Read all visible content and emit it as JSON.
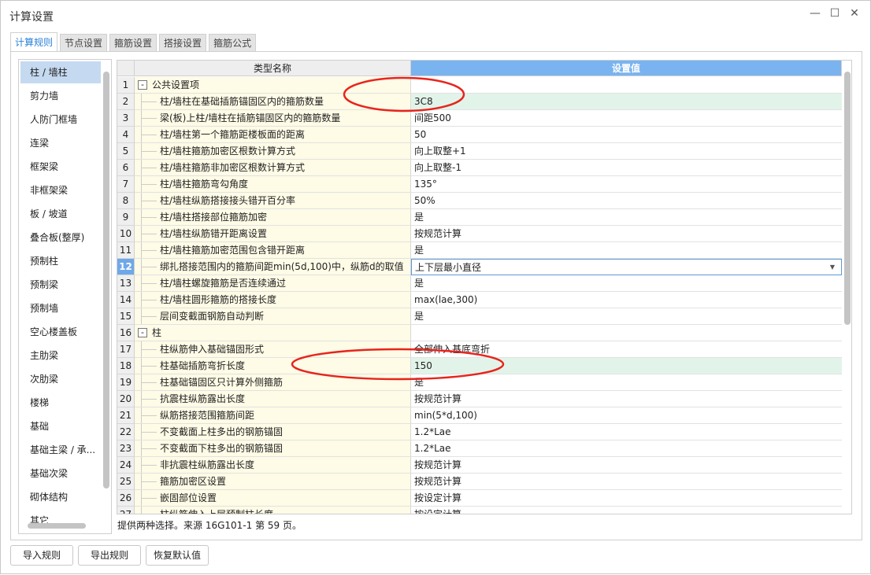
{
  "window": {
    "title": "计算设置",
    "controls": [
      "—",
      "☐",
      "✕"
    ]
  },
  "tabs": [
    "计算规则",
    "节点设置",
    "箍筋设置",
    "搭接设置",
    "箍筋公式"
  ],
  "left_list": [
    "柱 / 墙柱",
    "剪力墙",
    "人防门框墙",
    "连梁",
    "框架梁",
    "非框架梁",
    "板 / 坡道",
    "叠合板(整厚)",
    "预制柱",
    "预制梁",
    "预制墙",
    "空心楼盖板",
    "主肋梁",
    "次肋梁",
    "楼梯",
    "基础",
    "基础主梁 / 承...",
    "基础次梁",
    "砌体结构",
    "其它"
  ],
  "grid": {
    "headers": {
      "name": "类型名称",
      "value": "设置值"
    },
    "current_row": 12,
    "rows": [
      {
        "n": "1",
        "group": true,
        "name": "公共设置项",
        "value": ""
      },
      {
        "n": "2",
        "name": "柱/墙柱在基础插筋锚固区内的箍筋数量",
        "value": "3C8",
        "highlight": true
      },
      {
        "n": "3",
        "name": "梁(板)上柱/墙柱在插筋锚固区内的箍筋数量",
        "value": "间距500"
      },
      {
        "n": "4",
        "name": "柱/墙柱第一个箍筋距楼板面的距离",
        "value": "50"
      },
      {
        "n": "5",
        "name": "柱/墙柱箍筋加密区根数计算方式",
        "value": "向上取整+1"
      },
      {
        "n": "6",
        "name": "柱/墙柱箍筋非加密区根数计算方式",
        "value": "向上取整-1"
      },
      {
        "n": "7",
        "name": "柱/墙柱箍筋弯勾角度",
        "value": "135°"
      },
      {
        "n": "8",
        "name": "柱/墙柱纵筋搭接接头错开百分率",
        "value": "50%"
      },
      {
        "n": "9",
        "name": "柱/墙柱搭接部位箍筋加密",
        "value": "是"
      },
      {
        "n": "10",
        "name": "柱/墙柱纵筋错开距离设置",
        "value": "按规范计算"
      },
      {
        "n": "11",
        "name": "柱/墙柱箍筋加密范围包含错开距离",
        "value": "是"
      },
      {
        "n": "12",
        "name": "绑扎搭接范围内的箍筋间距min(5d,100)中，纵筋d的取值",
        "value": "上下层最小直径",
        "editing": true
      },
      {
        "n": "13",
        "name": "柱/墙柱螺旋箍筋是否连续通过",
        "value": "是"
      },
      {
        "n": "14",
        "name": "柱/墙柱圆形箍筋的搭接长度",
        "value": "max(lae,300)"
      },
      {
        "n": "15",
        "name": "层间变截面钢筋自动判断",
        "value": "是"
      },
      {
        "n": "16",
        "group": true,
        "name": "柱",
        "value": ""
      },
      {
        "n": "17",
        "name": "柱纵筋伸入基础锚固形式",
        "value": "全部伸入基底弯折"
      },
      {
        "n": "18",
        "name": "柱基础插筋弯折长度",
        "value": "150",
        "highlight": true
      },
      {
        "n": "19",
        "name": "柱基础锚固区只计算外侧箍筋",
        "value": "是"
      },
      {
        "n": "20",
        "name": "抗震柱纵筋露出长度",
        "value": "按规范计算"
      },
      {
        "n": "21",
        "name": "纵筋搭接范围箍筋间距",
        "value": "min(5*d,100)"
      },
      {
        "n": "22",
        "name": "不变截面上柱多出的钢筋锚固",
        "value": "1.2*Lae"
      },
      {
        "n": "23",
        "name": "不变截面下柱多出的钢筋锚固",
        "value": "1.2*Lae"
      },
      {
        "n": "24",
        "name": "非抗震柱纵筋露出长度",
        "value": "按规范计算"
      },
      {
        "n": "25",
        "name": "箍筋加密区设置",
        "value": "按规范计算"
      },
      {
        "n": "26",
        "name": "嵌固部位设置",
        "value": "按设定计算"
      },
      {
        "n": "27",
        "name": "柱纵筋伸入上层预制柱长度",
        "value": "按设定计算"
      }
    ]
  },
  "status": "提供两种选择。来源 16G101-1 第 59 页。",
  "buttons": {
    "import": "导入规则",
    "export": "导出规则",
    "reset": "恢复默认值"
  },
  "colors": {
    "accent": "#2a82d8",
    "header_value": "#7ab4f0",
    "name_bg": "#fefbe6",
    "highlight": "#e2f4ea",
    "annotation": "#e8241c"
  }
}
